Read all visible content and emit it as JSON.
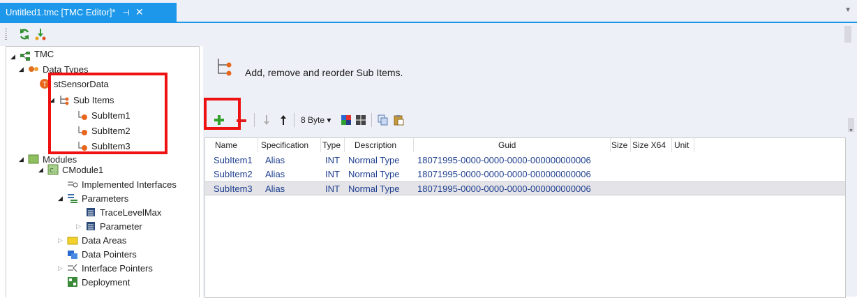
{
  "tab": {
    "title": "Untitled1.tmc [TMC Editor]*",
    "pin": "⊣",
    "close": "✕",
    "overflow": "▼"
  },
  "toolbar": {
    "refresh_icon": "refresh-icon",
    "merge_icon": "merge-icon"
  },
  "tree": {
    "root": "TMC",
    "data_types": "Data Types",
    "struct": "stSensorData",
    "sub_items": "Sub Items",
    "sub1": "SubItem1",
    "sub2": "SubItem2",
    "sub3": "SubItem3",
    "modules": "Modules",
    "module": "CModule1",
    "implemented_interfaces": "Implemented Interfaces",
    "parameters": "Parameters",
    "trace_level": "TraceLevelMax",
    "parameter": "Parameter",
    "data_areas": "Data Areas",
    "data_pointers": "Data Pointers",
    "interface_pointers": "Interface Pointers",
    "deployment": "Deployment"
  },
  "panel": {
    "heading": "Add, remove and reorder Sub Items."
  },
  "item_toolbar": {
    "byte_select": "8 Byte ▾",
    "colors": {
      "add": "#33a02c",
      "remove": "#e02020"
    }
  },
  "grid": {
    "columns": [
      "Name",
      "Specification",
      "Type",
      "Description",
      "Guid",
      "Size",
      "Size X64",
      "Unit"
    ],
    "rows": [
      {
        "name": "SubItem1",
        "spec": "Alias",
        "type": "INT",
        "desc": "Normal Type",
        "guid": "18071995-0000-0000-0000-000000000006"
      },
      {
        "name": "SubItem2",
        "spec": "Alias",
        "type": "INT",
        "desc": "Normal Type",
        "guid": "18071995-0000-0000-0000-000000000006"
      },
      {
        "name": "SubItem3",
        "spec": "Alias",
        "type": "INT",
        "desc": "Normal Type",
        "guid": "18071995-0000-0000-0000-000000000006"
      }
    ],
    "selected_row": 2
  },
  "colors": {
    "accent": "#1c97ea",
    "highlight": "#ee1111",
    "cell_text": "#1f3f8f"
  }
}
